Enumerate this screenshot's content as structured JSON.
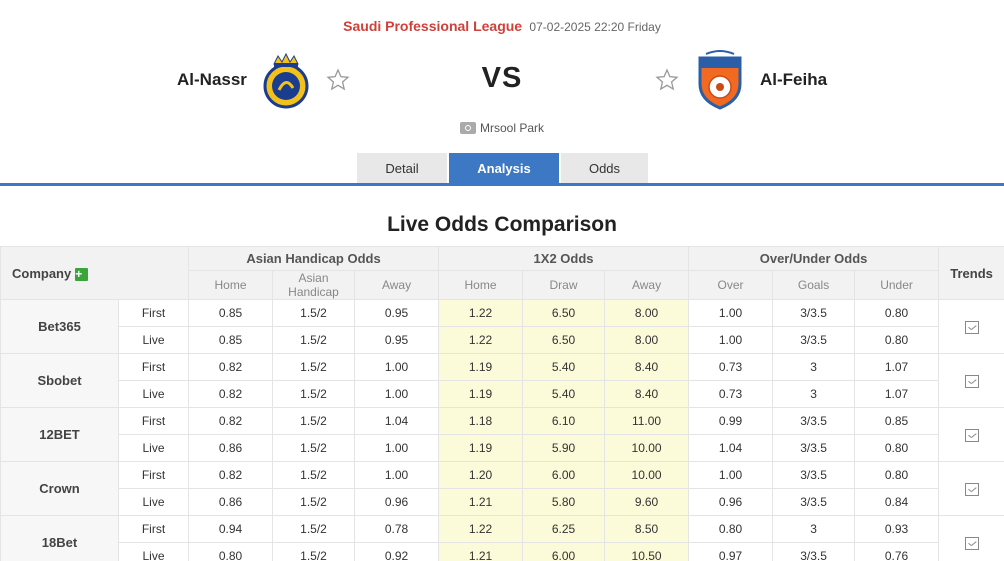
{
  "match": {
    "league": "Saudi Professional League",
    "datetime": "07-02-2025 22:20 Friday",
    "home_team": "Al-Nassr",
    "away_team": "Al-Feiha",
    "vs_label": "VS",
    "venue": "Mrsool Park"
  },
  "tabs": [
    {
      "label": "Detail"
    },
    {
      "label": "Analysis",
      "active": true
    },
    {
      "label": "Odds"
    }
  ],
  "colors": {
    "league": "#d0403a",
    "active_tab": "#3c78c3",
    "x12_highlight": "#fbfbd9",
    "plus_icon": "#3aa43a"
  },
  "odds_table": {
    "title": "Live Odds Comparison",
    "company_header": "Company",
    "trends_header": "Trends",
    "group_headers": {
      "asian": "Asian Handicap Odds",
      "x12": "1X2 Odds",
      "ou": "Over/Under Odds"
    },
    "sub_headers": {
      "asian": [
        "Home",
        "Asian Handicap",
        "Away"
      ],
      "x12": [
        "Home",
        "Draw",
        "Away"
      ],
      "ou": [
        "Over",
        "Goals",
        "Under"
      ]
    },
    "companies": [
      {
        "name": "Bet365",
        "rows": [
          {
            "kind": "First",
            "ah": [
              "0.85",
              "1.5/2",
              "0.95"
            ],
            "x12": [
              "1.22",
              "6.50",
              "8.00"
            ],
            "ou": [
              "1.00",
              "3/3.5",
              "0.80"
            ]
          },
          {
            "kind": "Live",
            "ah": [
              "0.85",
              "1.5/2",
              "0.95"
            ],
            "x12": [
              "1.22",
              "6.50",
              "8.00"
            ],
            "ou": [
              "1.00",
              "3/3.5",
              "0.80"
            ]
          }
        ]
      },
      {
        "name": "Sbobet",
        "rows": [
          {
            "kind": "First",
            "ah": [
              "0.82",
              "1.5/2",
              "1.00"
            ],
            "x12": [
              "1.19",
              "5.40",
              "8.40"
            ],
            "ou": [
              "0.73",
              "3",
              "1.07"
            ]
          },
          {
            "kind": "Live",
            "ah": [
              "0.82",
              "1.5/2",
              "1.00"
            ],
            "x12": [
              "1.19",
              "5.40",
              "8.40"
            ],
            "ou": [
              "0.73",
              "3",
              "1.07"
            ]
          }
        ]
      },
      {
        "name": "12BET",
        "rows": [
          {
            "kind": "First",
            "ah": [
              "0.82",
              "1.5/2",
              "1.04"
            ],
            "x12": [
              "1.18",
              "6.10",
              "11.00"
            ],
            "ou": [
              "0.99",
              "3/3.5",
              "0.85"
            ]
          },
          {
            "kind": "Live",
            "ah": [
              "0.86",
              "1.5/2",
              "1.00"
            ],
            "x12": [
              "1.19",
              "5.90",
              "10.00"
            ],
            "ou": [
              "1.04",
              "3/3.5",
              "0.80"
            ]
          }
        ]
      },
      {
        "name": "Crown",
        "rows": [
          {
            "kind": "First",
            "ah": [
              "0.82",
              "1.5/2",
              "1.00"
            ],
            "x12": [
              "1.20",
              "6.00",
              "10.00"
            ],
            "ou": [
              "1.00",
              "3/3.5",
              "0.80"
            ]
          },
          {
            "kind": "Live",
            "ah": [
              "0.86",
              "1.5/2",
              "0.96"
            ],
            "x12": [
              "1.21",
              "5.80",
              "9.60"
            ],
            "ou": [
              "0.96",
              "3/3.5",
              "0.84"
            ]
          }
        ]
      },
      {
        "name": "18Bet",
        "rows": [
          {
            "kind": "First",
            "ah": [
              "0.94",
              "1.5/2",
              "0.78"
            ],
            "x12": [
              "1.22",
              "6.25",
              "8.50"
            ],
            "ou": [
              "0.80",
              "3",
              "0.93"
            ]
          },
          {
            "kind": "Live",
            "ah": [
              "0.80",
              "1.5/2",
              "0.92"
            ],
            "x12": [
              "1.21",
              "6.00",
              "10.50"
            ],
            "ou": [
              "0.97",
              "3/3.5",
              "0.76"
            ]
          }
        ]
      }
    ]
  }
}
